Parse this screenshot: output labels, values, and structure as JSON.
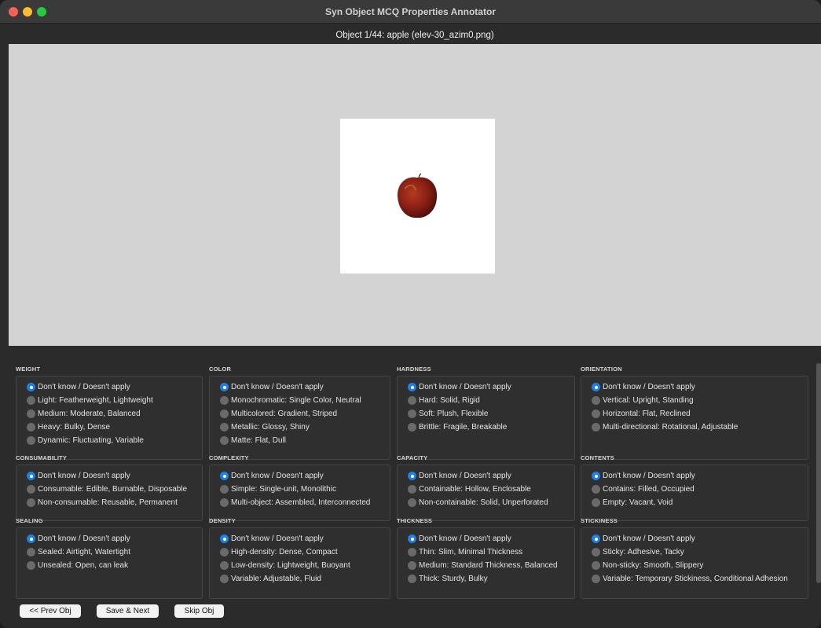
{
  "window": {
    "title": "Syn Object MCQ Properties Annotator"
  },
  "header": {
    "object_label": "Object 1/44: apple (elev-30_azim0.png)"
  },
  "groups": [
    {
      "title": "WEIGHT",
      "options": [
        "Don't know / Doesn't apply",
        "Light: Featherweight, Lightweight",
        "Medium: Moderate, Balanced",
        "Heavy: Bulky, Dense",
        "Dynamic: Fluctuating, Variable"
      ],
      "selected": 0
    },
    {
      "title": "COLOR",
      "options": [
        "Don't know / Doesn't apply",
        "Monochromatic: Single Color, Neutral",
        "Multicolored: Gradient, Striped",
        "Metallic: Glossy, Shiny",
        "Matte: Flat, Dull"
      ],
      "selected": 0
    },
    {
      "title": "HARDNESS",
      "options": [
        "Don't know / Doesn't apply",
        "Hard: Solid, Rigid",
        "Soft: Plush, Flexible",
        "Brittle: Fragile, Breakable"
      ],
      "selected": 0
    },
    {
      "title": "ORIENTATION",
      "options": [
        "Don't know / Doesn't apply",
        "Vertical: Upright, Standing",
        "Horizontal: Flat, Reclined",
        "Multi-directional: Rotational, Adjustable"
      ],
      "selected": 0
    },
    {
      "title": "CONSUMABILITY",
      "options": [
        "Don't know / Doesn't apply",
        "Consumable: Edible, Burnable, Disposable",
        "Non-consumable: Reusable, Permanent"
      ],
      "selected": 0
    },
    {
      "title": "COMPLEXITY",
      "options": [
        "Don't know / Doesn't apply",
        "Simple: Single-unit, Monolithic",
        "Multi-object: Assembled, Interconnected"
      ],
      "selected": 0
    },
    {
      "title": "CAPACITY",
      "options": [
        "Don't know / Doesn't apply",
        "Containable: Hollow, Enclosable",
        "Non-containable: Solid, Unperforated"
      ],
      "selected": 0
    },
    {
      "title": "CONTENTS",
      "options": [
        "Don't know / Doesn't apply",
        "Contains: Filled, Occupied",
        "Empty: Vacant, Void"
      ],
      "selected": 0
    },
    {
      "title": "SEALING",
      "options": [
        "Don't know / Doesn't apply",
        "Sealed: Airtight, Watertight",
        "Unsealed: Open, can leak"
      ],
      "selected": 0
    },
    {
      "title": "DENSITY",
      "options": [
        "Don't know / Doesn't apply",
        "High-density: Dense, Compact",
        "Low-density: Lightweight, Buoyant",
        "Variable: Adjustable, Fluid"
      ],
      "selected": 0
    },
    {
      "title": "THICKNESS",
      "options": [
        "Don't know / Doesn't apply",
        "Thin: Slim, Minimal Thickness",
        "Medium: Standard Thickness, Balanced",
        "Thick: Sturdy, Bulky"
      ],
      "selected": 0
    },
    {
      "title": "STICKINESS",
      "options": [
        "Don't know / Doesn't apply",
        "Sticky: Adhesive, Tacky",
        "Non-sticky: Smooth, Slippery",
        "Variable: Temporary Stickiness, Conditional Adhesion"
      ],
      "selected": 0
    }
  ],
  "buttons": {
    "prev": "<< Prev Obj",
    "save_next": "Save & Next",
    "skip": "Skip Obj"
  },
  "colors": {
    "accent": "#1e7fe6",
    "radio_off": "#6a6a6a",
    "panel_bg": "#2b2b2b",
    "viewer_bg": "#d3d3d3"
  }
}
